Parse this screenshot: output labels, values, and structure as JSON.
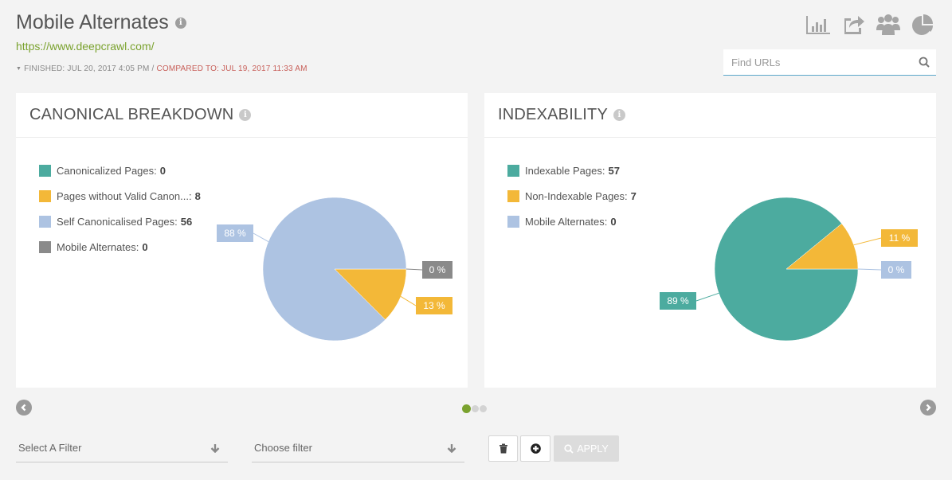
{
  "header": {
    "title": "Mobile Alternates",
    "url": "https://www.deepcrawl.com/",
    "finished": "FINISHED: JUL 20, 2017 4:05 PM",
    "separator": "/",
    "compared": "COMPARED TO: JUL 19, 2017 11:33 AM"
  },
  "toolbar": {
    "icons": [
      "bar-chart-icon",
      "share-icon",
      "users-icon",
      "pie-chart-icon"
    ]
  },
  "search": {
    "placeholder": "Find URLs",
    "value": ""
  },
  "colors": {
    "teal": "#4cab9f",
    "yellow": "#f3b838",
    "light_blue": "#adc3e2",
    "gray": "#8a8a8a",
    "accent_green": "#7aa22e",
    "compared_red": "#c8605a"
  },
  "panels": [
    {
      "title": "CANONICAL BREAKDOWN",
      "legend": [
        {
          "label": "Canonicalized Pages:",
          "value": "0",
          "color": "#4cab9f"
        },
        {
          "label": "Pages without Valid Canon...:",
          "value": "8",
          "color": "#f3b838"
        },
        {
          "label": "Self Canonicalised Pages:",
          "value": "56",
          "color": "#adc3e2"
        },
        {
          "label": "Mobile Alternates:",
          "value": "0",
          "color": "#8a8a8a"
        }
      ]
    },
    {
      "title": "INDEXABILITY",
      "legend": [
        {
          "label": "Indexable Pages:",
          "value": "57",
          "color": "#4cab9f"
        },
        {
          "label": "Non-Indexable Pages:",
          "value": "7",
          "color": "#f3b838"
        },
        {
          "label": "Mobile Alternates:",
          "value": "0",
          "color": "#adc3e2"
        }
      ]
    }
  ],
  "chart_data": [
    {
      "type": "pie",
      "title": "CANONICAL BREAKDOWN",
      "categories": [
        "Canonicalized Pages",
        "Pages without Valid Canon...",
        "Self Canonicalised Pages",
        "Mobile Alternates"
      ],
      "values": [
        0,
        8,
        56,
        0
      ],
      "data_labels": [
        "",
        "13 %",
        "88 %",
        "0 %"
      ],
      "colors": [
        "#4cab9f",
        "#f3b838",
        "#adc3e2",
        "#8a8a8a"
      ],
      "legend_position": "left"
    },
    {
      "type": "pie",
      "title": "INDEXABILITY",
      "categories": [
        "Indexable Pages",
        "Non-Indexable Pages",
        "Mobile Alternates"
      ],
      "values": [
        57,
        7,
        0
      ],
      "data_labels": [
        "89 %",
        "11 %",
        "0 %"
      ],
      "colors": [
        "#4cab9f",
        "#f3b838",
        "#adc3e2"
      ],
      "legend_position": "left"
    }
  ],
  "carousel": {
    "pages": 3,
    "active": 1
  },
  "filters": {
    "filter1": "Select A Filter",
    "filter2": "Choose filter",
    "apply_label": "APPLY"
  }
}
